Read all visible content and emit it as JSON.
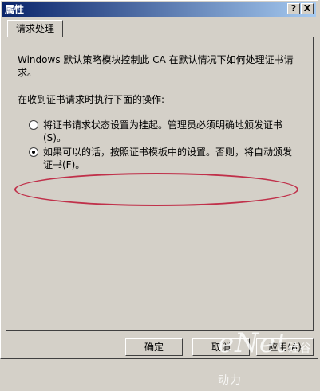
{
  "window": {
    "title": "属性",
    "help_button": "?",
    "close_button": "X"
  },
  "tabs": [
    {
      "label": "请求处理"
    }
  ],
  "content": {
    "description": "Windows 默认策略模块控制此 CA 在默认情况下如何处理证书请求。",
    "prompt": "在收到证书请求时执行下面的操作:",
    "options": [
      {
        "label": "将证书请求状态设置为挂起。管理员必须明确地颁发证书(S)。",
        "selected": false
      },
      {
        "label": "如果可以的话，按照证书模板中的设置。否则，将自动颁发证书(F)。",
        "selected": true
      }
    ]
  },
  "buttons": {
    "ok": "确定",
    "cancel": "取消",
    "apply": "应用(A)"
  },
  "watermark": {
    "text": "eNet",
    "subtext": "硅谷动力"
  },
  "colors": {
    "titlebar_start": "#0a246a",
    "titlebar_end": "#a6caf0",
    "highlight_ellipse": "#c0304a"
  }
}
